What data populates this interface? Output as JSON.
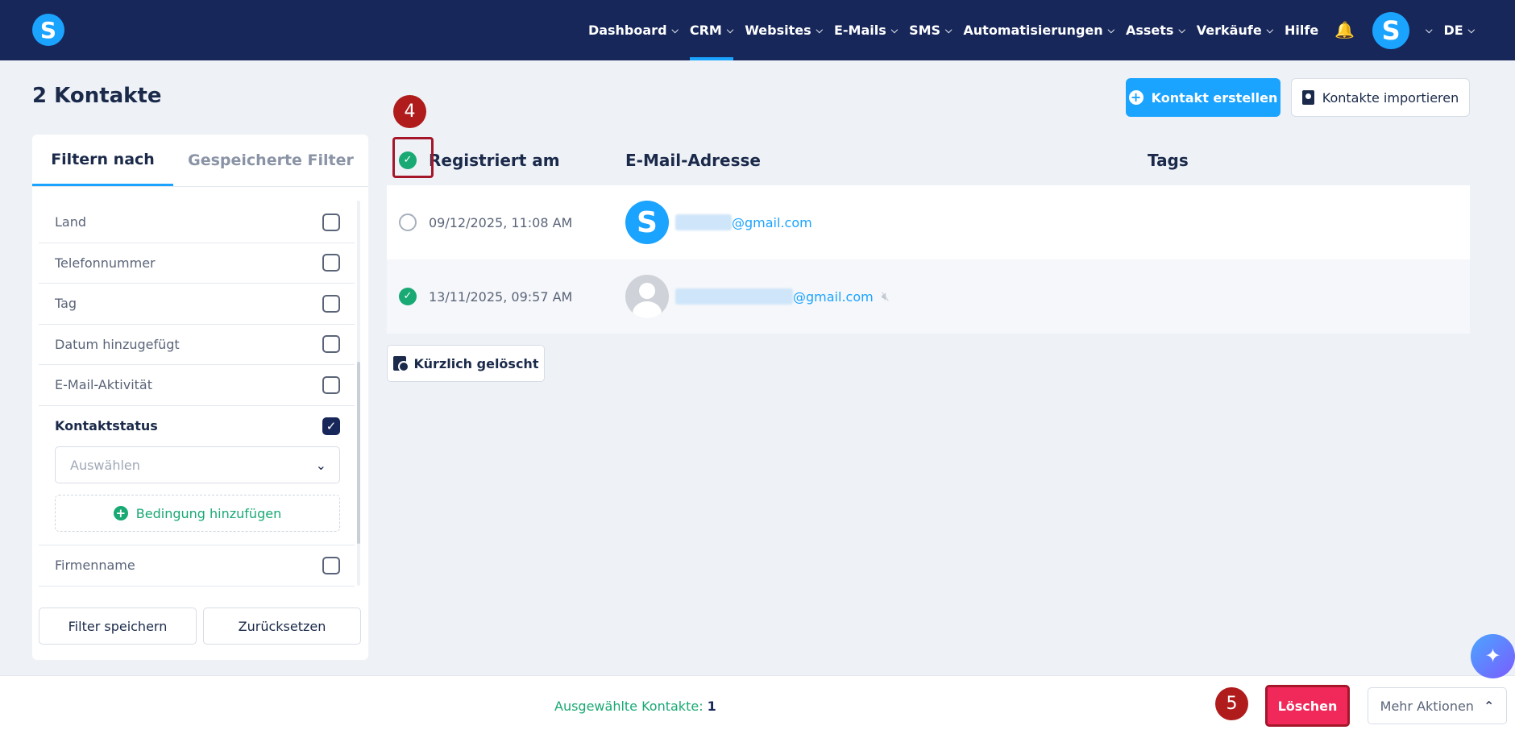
{
  "nav": {
    "items": [
      {
        "label": "Dashboard",
        "dropdown": true,
        "active": false
      },
      {
        "label": "CRM",
        "dropdown": true,
        "active": true
      },
      {
        "label": "Websites",
        "dropdown": true,
        "active": false
      },
      {
        "label": "E-Mails",
        "dropdown": true,
        "active": false
      },
      {
        "label": "SMS",
        "dropdown": true,
        "active": false
      },
      {
        "label": "Automatisierungen",
        "dropdown": true,
        "active": false
      },
      {
        "label": "Assets",
        "dropdown": true,
        "active": false
      },
      {
        "label": "Verkäufe",
        "dropdown": true,
        "active": false
      },
      {
        "label": "Hilfe",
        "dropdown": false,
        "active": false
      }
    ],
    "language": "DE",
    "logo_letter": "S",
    "avatar_letter": "S"
  },
  "page": {
    "title": "2 Kontakte",
    "create_button": "Kontakt erstellen",
    "import_button": "Kontakte importieren"
  },
  "filters": {
    "tabs": [
      "Filtern nach",
      "Gespeicherte Filter"
    ],
    "items": [
      {
        "label": "Land",
        "checked": false
      },
      {
        "label": "Telefonnummer",
        "checked": false
      },
      {
        "label": "Tag",
        "checked": false
      },
      {
        "label": "Datum hinzugefügt",
        "checked": false
      },
      {
        "label": "E-Mail-Aktivität",
        "checked": false
      },
      {
        "label": "Kontaktstatus",
        "checked": true
      },
      {
        "label": "Firmenname",
        "checked": false
      }
    ],
    "select_placeholder": "Auswählen",
    "add_condition": "Bedingung hinzufügen",
    "save_button": "Filter speichern",
    "reset_button": "Zurücksetzen"
  },
  "table": {
    "columns": [
      "Registriert am",
      "E-Mail-Adresse",
      "Tags"
    ],
    "rows": [
      {
        "selected": false,
        "date": "09/12/2025, 11:08 AM",
        "email_domain": "@gmail.com",
        "avatar": "S"
      },
      {
        "selected": true,
        "date": "13/11/2025, 09:57 AM",
        "email_domain": "@gmail.com",
        "avatar": "generic"
      }
    ],
    "recently_deleted": "Kürzlich gelöscht"
  },
  "footer": {
    "selected_label": "Ausgewählte Kontakte:",
    "selected_count": "1",
    "delete_button": "Löschen",
    "more_actions": "Mehr Aktionen"
  },
  "annotations": {
    "step4": "4",
    "step5": "5"
  },
  "colors": {
    "nav_bg": "#17275a",
    "accent": "#1aa3ff",
    "success": "#19a974",
    "danger": "#f0295a",
    "annotation": "#b01c1c"
  }
}
